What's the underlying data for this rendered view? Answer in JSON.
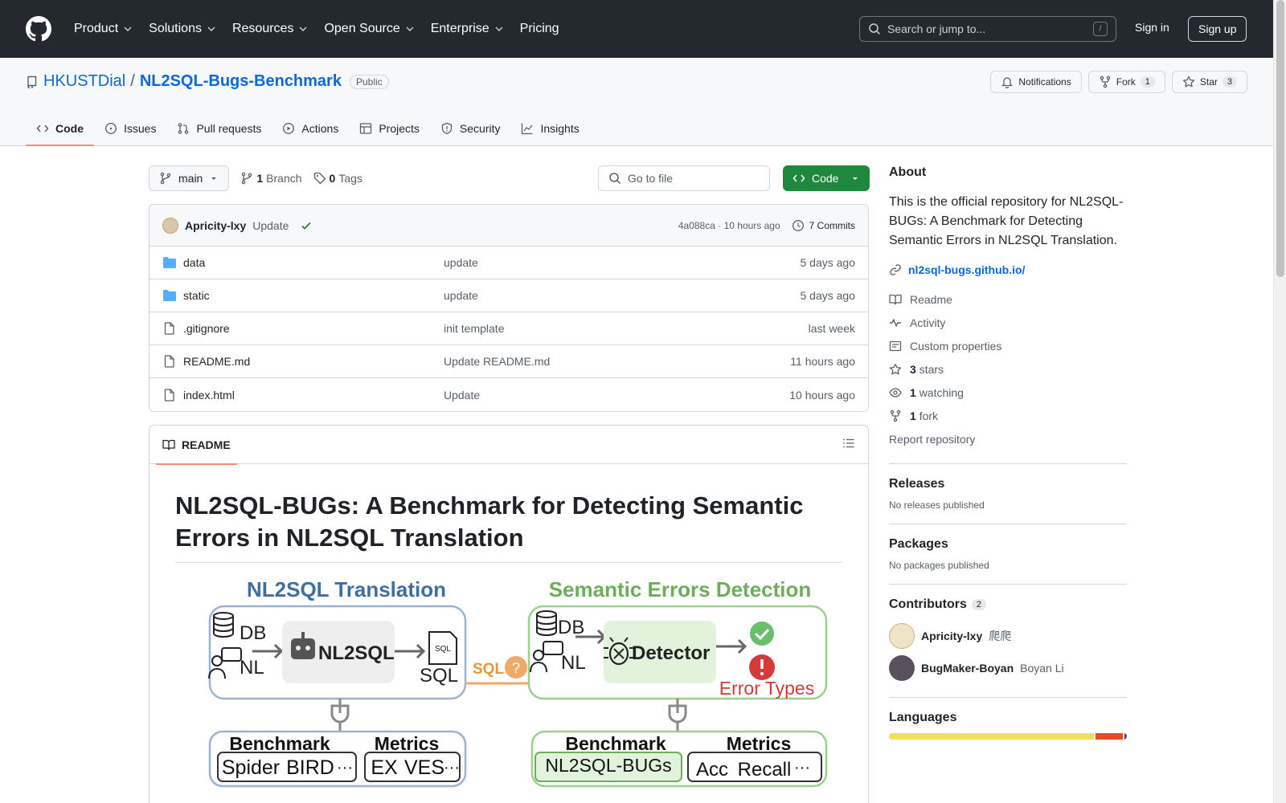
{
  "header": {
    "nav": [
      {
        "label": "Product",
        "has_menu": true
      },
      {
        "label": "Solutions",
        "has_menu": true
      },
      {
        "label": "Resources",
        "has_menu": true
      },
      {
        "label": "Open Source",
        "has_menu": true
      },
      {
        "label": "Enterprise",
        "has_menu": true
      },
      {
        "label": "Pricing",
        "has_menu": false
      }
    ],
    "search_placeholder": "Search or jump to...",
    "search_shortcut": "/",
    "sign_in": "Sign in",
    "sign_up": "Sign up"
  },
  "repo": {
    "owner": "HKUSTDial",
    "separator": "/",
    "name": "NL2SQL-Bugs-Benchmark",
    "visibility": "Public",
    "notifications": "Notifications",
    "fork_label": "Fork",
    "fork_count": "1",
    "star_label": "Star",
    "star_count": "3",
    "tabs": [
      {
        "label": "Code",
        "icon": "code-icon",
        "active": true
      },
      {
        "label": "Issues",
        "icon": "issue-icon",
        "active": false
      },
      {
        "label": "Pull requests",
        "icon": "pull-request-icon",
        "active": false
      },
      {
        "label": "Actions",
        "icon": "play-icon",
        "active": false
      },
      {
        "label": "Projects",
        "icon": "table-icon",
        "active": false
      },
      {
        "label": "Security",
        "icon": "shield-icon",
        "active": false
      },
      {
        "label": "Insights",
        "icon": "graph-icon",
        "active": false
      }
    ]
  },
  "filenav": {
    "branch": "main",
    "branches_count": "1",
    "branches_label": "Branch",
    "tags_count": "0",
    "tags_label": "Tags",
    "goto_placeholder": "Go to file",
    "code_button": "Code"
  },
  "commit": {
    "author": "Apricity-lxy",
    "message": "Update",
    "hash": "4a088ca",
    "dot": "·",
    "time": "10 hours ago",
    "commits": "7 Commits"
  },
  "files": [
    {
      "type": "folder",
      "name": "data",
      "message": "update",
      "time": "5 days ago"
    },
    {
      "type": "folder",
      "name": "static",
      "message": "update",
      "time": "5 days ago"
    },
    {
      "type": "file",
      "name": ".gitignore",
      "message": "init template",
      "time": "last week"
    },
    {
      "type": "file",
      "name": "README.md",
      "message": "Update README.md",
      "time": "11 hours ago"
    },
    {
      "type": "file",
      "name": "index.html",
      "message": "Update",
      "time": "10 hours ago"
    }
  ],
  "readme": {
    "tab_label": "README",
    "title": "NL2SQL-BUGs: A Benchmark for Detecting Semantic Errors in NL2SQL Translation",
    "figure": {
      "left_title": "NL2SQL Translation",
      "right_title": "Semantic Errors Detection",
      "db": "DB",
      "nl": "NL",
      "nl2sql": "NL2SQL",
      "sql": "SQL",
      "sql_file": "SQL",
      "sql_arrow": "SQL",
      "question": "?",
      "detector": "Detector",
      "error_types": "Error Types",
      "benchmark": "Benchmark",
      "metrics": "Metrics",
      "left_benchmarks": [
        "Spider",
        "BIRD",
        "···"
      ],
      "left_metrics": [
        "EX",
        "VES",
        "···"
      ],
      "right_benchmarks": [
        "NL2SQL-BUGs"
      ],
      "right_metrics": [
        "Acc",
        "Recall",
        "···"
      ]
    }
  },
  "sidebar": {
    "about_title": "About",
    "about_text": "This is the official repository for NL2SQL-BUGs: A Benchmark for Detecting Semantic Errors in NL2SQL Translation.",
    "website": "nl2sql-bugs.github.io/",
    "readme": "Readme",
    "activity": "Activity",
    "custom_properties": "Custom properties",
    "stars_count": "3",
    "stars_label": "stars",
    "watching_count": "1",
    "watching_label": "watching",
    "forks_count": "1",
    "forks_label": "fork",
    "report": "Report repository",
    "releases_title": "Releases",
    "releases_empty": "No releases published",
    "packages_title": "Packages",
    "packages_empty": "No packages published",
    "contributors_title": "Contributors",
    "contributors_count": "2",
    "contributors": [
      {
        "login": "Apricity-lxy",
        "name": "爬爬"
      },
      {
        "login": "BugMaker-Boyan",
        "name": "Boyan Li"
      }
    ],
    "languages_title": "Languages",
    "language_colors": [
      "#f1e05a",
      "#e34c26",
      "#663399"
    ],
    "language_shares": [
      0.873,
      0.117,
      0.01
    ]
  }
}
